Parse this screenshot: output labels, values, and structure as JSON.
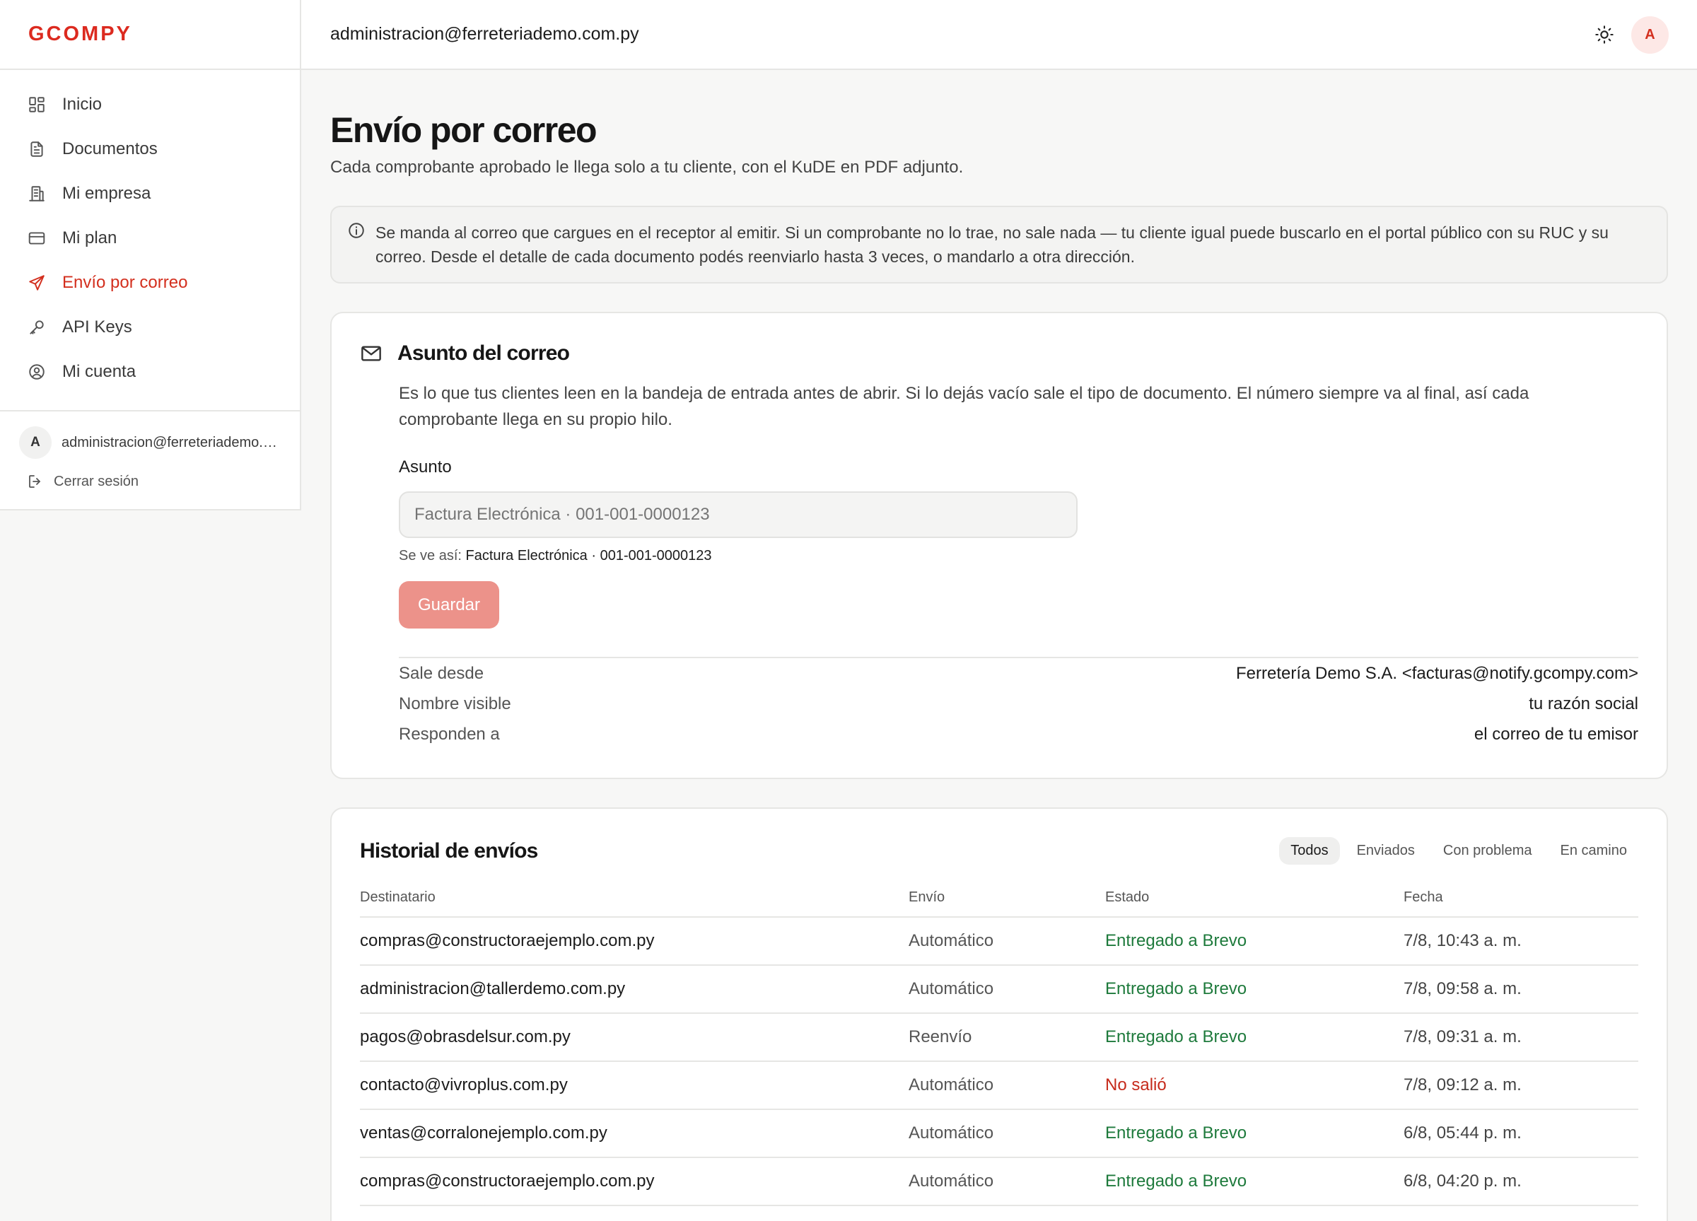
{
  "app": {
    "logo": "GCOMPY"
  },
  "sidebar": {
    "items": [
      {
        "label": "Inicio",
        "icon": "grid-icon"
      },
      {
        "label": "Documentos",
        "icon": "document-icon"
      },
      {
        "label": "Mi empresa",
        "icon": "building-icon"
      },
      {
        "label": "Mi plan",
        "icon": "credit-card-icon"
      },
      {
        "label": "Envío por correo",
        "icon": "send-icon",
        "active": true
      },
      {
        "label": "API Keys",
        "icon": "key-icon"
      },
      {
        "label": "Mi cuenta",
        "icon": "user-circle-icon"
      }
    ],
    "user": {
      "avatar": "A",
      "email": "administracion@ferreteriademo.com.py"
    },
    "logout_label": "Cerrar sesión"
  },
  "topbar": {
    "email": "administracion@ferreteriademo.com.py",
    "avatar": "A"
  },
  "page": {
    "title": "Envío por correo",
    "subtitle": "Cada comprobante aprobado le llega solo a tu cliente, con el KuDE en PDF adjunto."
  },
  "info": {
    "text": "Se manda al correo que cargues en el receptor al emitir. Si un comprobante no lo trae, no sale nada — tu cliente igual puede buscarlo en el portal público con su RUC y su correo. Desde el detalle de cada documento podés reenviarlo hasta 3 veces, o mandarlo a otra dirección."
  },
  "subject_card": {
    "title": "Asunto del correo",
    "description": "Es lo que tus clientes leen en la bandeja de entrada antes de abrir. Si lo dejás vacío sale el tipo de documento. El número siempre va al final, así cada comprobante llega en su propio hilo.",
    "field_label": "Asunto",
    "field_placeholder": "Factura Electrónica · 001-001-0000123",
    "preview_label": "Se ve así:",
    "preview_value": "Factura Electrónica · 001-001-0000123",
    "save_label": "Guardar",
    "details": [
      {
        "key": "Sale desde",
        "value": "Ferretería Demo S.A. <facturas@notify.gcompy.com>"
      },
      {
        "key": "Nombre visible",
        "value": "tu razón social"
      },
      {
        "key": "Responden a",
        "value": "el correo de tu emisor"
      }
    ]
  },
  "history": {
    "title": "Historial de envíos",
    "filters": [
      "Todos",
      "Enviados",
      "Con problema",
      "En camino"
    ],
    "active_filter": "Todos",
    "columns": [
      "Destinatario",
      "Envío",
      "Estado",
      "Fecha"
    ],
    "rows": [
      {
        "recipient": "compras@constructoraejemplo.com.py",
        "method": "Automático",
        "status": "Entregado a Brevo",
        "status_kind": "ok",
        "date": "7/8, 10:43 a. m."
      },
      {
        "recipient": "administracion@tallerdemo.com.py",
        "method": "Automático",
        "status": "Entregado a Brevo",
        "status_kind": "ok",
        "date": "7/8, 09:58 a. m."
      },
      {
        "recipient": "pagos@obrasdelsur.com.py",
        "method": "Reenvío",
        "status": "Entregado a Brevo",
        "status_kind": "ok",
        "date": "7/8, 09:31 a. m."
      },
      {
        "recipient": "contacto@vivroplus.com.py",
        "method": "Automático",
        "status": "No salió",
        "status_kind": "fail",
        "date": "7/8, 09:12 a. m."
      },
      {
        "recipient": "ventas@corralonejemplo.com.py",
        "method": "Automático",
        "status": "Entregado a Brevo",
        "status_kind": "ok",
        "date": "6/8, 05:44 p. m."
      },
      {
        "recipient": "compras@constructoraejemplo.com.py",
        "method": "Automático",
        "status": "Entregado a Brevo",
        "status_kind": "ok",
        "date": "6/8, 04:20 p. m."
      }
    ]
  },
  "colors": {
    "brand": "#dc2a1f",
    "success": "#1e7a3c",
    "error": "#c62b1c",
    "button_disabled": "#ec928a"
  }
}
